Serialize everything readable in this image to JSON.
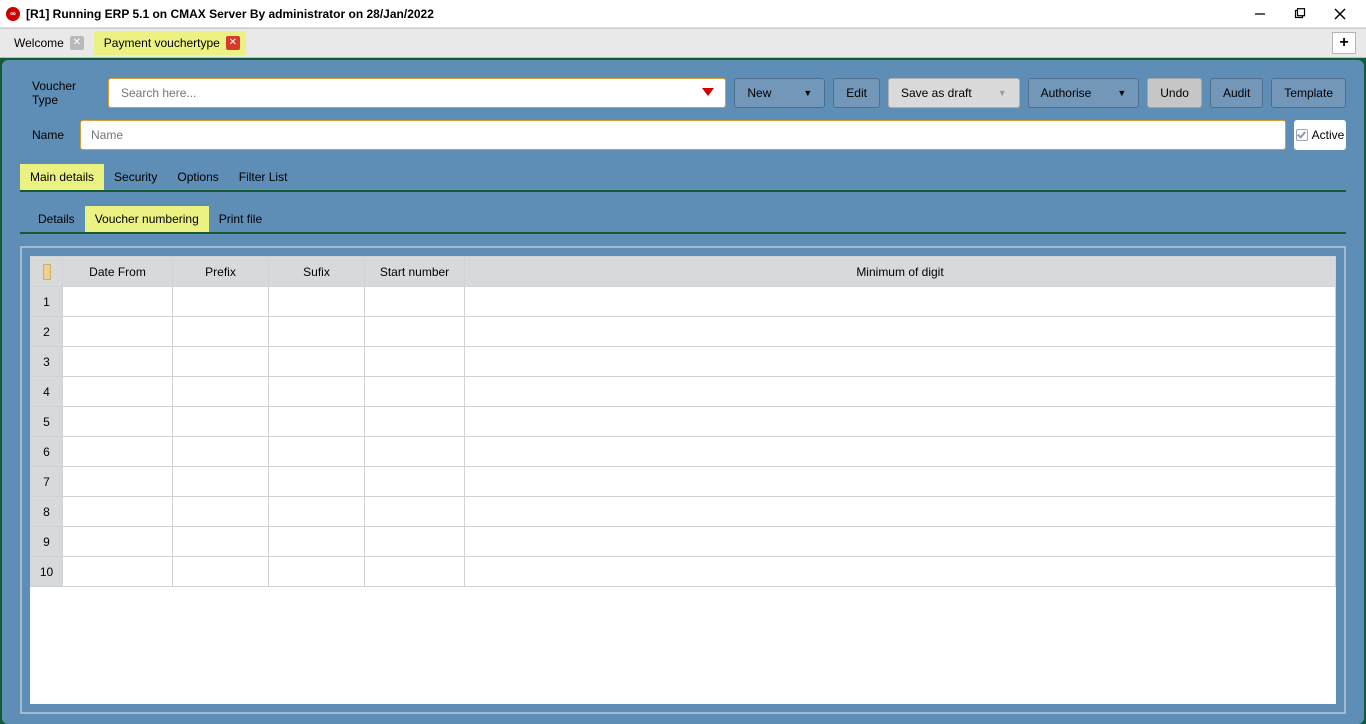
{
  "titlebar": {
    "text": "[R1] Running ERP 5.1 on CMAX Server By administrator on 28/Jan/2022"
  },
  "doc_tabs": {
    "welcome": "Welcome",
    "payment": "Payment vouchertype",
    "add": "+"
  },
  "toolbar": {
    "voucher_type_label": "Voucher Type",
    "search_placeholder": "Search here...",
    "new": "New",
    "edit": "Edit",
    "save_draft": "Save as draft",
    "authorise": "Authorise",
    "undo": "Undo",
    "audit": "Audit",
    "template": "Template"
  },
  "name_row": {
    "label": "Name",
    "placeholder": "Name",
    "active": "Active"
  },
  "main_tabs": {
    "main_details": "Main details",
    "security": "Security",
    "options": "Options",
    "filter_list": "Filter List"
  },
  "sub_tabs": {
    "details": "Details",
    "voucher_numbering": "Voucher numbering",
    "print_file": "Print file"
  },
  "grid": {
    "headers": {
      "date_from": "Date From",
      "prefix": "Prefix",
      "suffix": "Sufix",
      "start_number": "Start number",
      "min_digit": "Minimum of digit"
    },
    "rows": [
      {
        "n": "1"
      },
      {
        "n": "2"
      },
      {
        "n": "3"
      },
      {
        "n": "4"
      },
      {
        "n": "5"
      },
      {
        "n": "6"
      },
      {
        "n": "7"
      },
      {
        "n": "8"
      },
      {
        "n": "9"
      },
      {
        "n": "10"
      }
    ]
  }
}
